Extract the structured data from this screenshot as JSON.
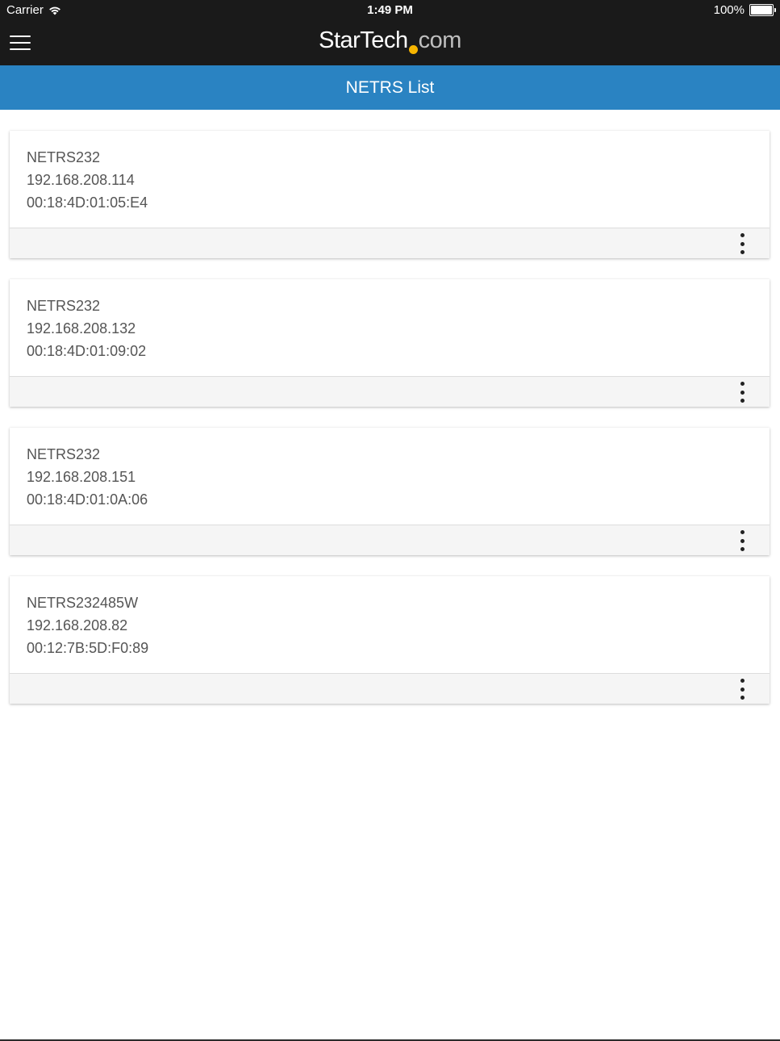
{
  "status_bar": {
    "carrier": "Carrier",
    "time": "1:49 PM",
    "battery": "100%"
  },
  "header": {
    "logo_main": "StarTech",
    "logo_suffix": "com",
    "menu_icon": "hamburger-menu-icon"
  },
  "title_bar": {
    "title": "NETRS List"
  },
  "devices": [
    {
      "model": "NETRS232",
      "ip": "192.168.208.114",
      "mac": "00:18:4D:01:05:E4"
    },
    {
      "model": "NETRS232",
      "ip": "192.168.208.132",
      "mac": "00:18:4D:01:09:02"
    },
    {
      "model": "NETRS232",
      "ip": "192.168.208.151",
      "mac": "00:18:4D:01:0A:06"
    },
    {
      "model": "NETRS232485W",
      "ip": "192.168.208.82",
      "mac": "00:12:7B:5D:F0:89"
    }
  ],
  "colors": {
    "header_bg": "#1a1a1a",
    "title_bar_bg": "#2a83c2",
    "logo_dot": "#f7b500",
    "card_footer_bg": "#f5f5f5"
  },
  "icons": {
    "wifi": "wifi-icon",
    "battery": "battery-icon",
    "more": "more-vertical-icon"
  }
}
